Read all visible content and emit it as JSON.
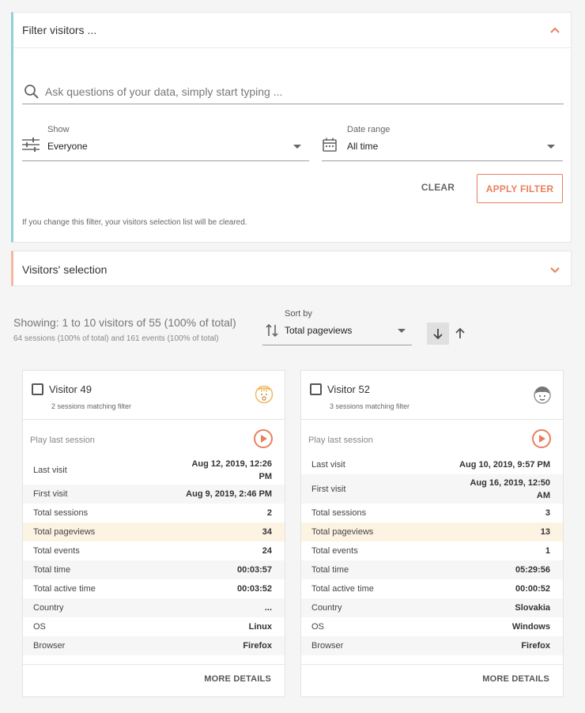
{
  "filter": {
    "title": "Filter visitors ...",
    "search_placeholder": "Ask questions of your data, simply start typing ...",
    "show": {
      "label": "Show",
      "value": "Everyone"
    },
    "date_range": {
      "label": "Date range",
      "value": "All time"
    },
    "clear_label": "CLEAR",
    "apply_label": "APPLY FILTER",
    "note": "If you change this filter, your visitors selection list will be cleared.",
    "accent": "#8fd1d4"
  },
  "selection": {
    "title": "Visitors' selection",
    "accent": "#f4b8a2"
  },
  "summary": {
    "showing": "Showing: 1 to 10 visitors of 55 (100% of total)",
    "sub": "64 sessions (100% of total) and 161 events (100% of total)"
  },
  "sort": {
    "label": "Sort by",
    "value": "Total pageviews"
  },
  "brand_color": "#e8805f",
  "cards": [
    {
      "name": "Visitor 49",
      "sub": "2 sessions matching filter",
      "avatar": "surprised-face-icon",
      "play_label": "Play last session",
      "stats": [
        {
          "k": "Last visit",
          "v": "Aug 12, 2019, 12:26 PM"
        },
        {
          "k": "First visit",
          "v": "Aug 9, 2019, 2:46 PM"
        },
        {
          "k": "Total sessions",
          "v": "2"
        },
        {
          "k": "Total pageviews",
          "v": "34"
        },
        {
          "k": "Total events",
          "v": "24"
        },
        {
          "k": "Total time",
          "v": "00:03:57"
        },
        {
          "k": "Total active time",
          "v": "00:03:52"
        },
        {
          "k": "Country",
          "v": "..."
        },
        {
          "k": "OS",
          "v": "Linux"
        },
        {
          "k": "Browser",
          "v": "Firefox"
        }
      ],
      "more_label": "MORE DETAILS"
    },
    {
      "name": "Visitor 52",
      "sub": "3 sessions matching filter",
      "avatar": "boy-face-icon",
      "play_label": "Play last session",
      "stats": [
        {
          "k": "Last visit",
          "v": "Aug 10, 2019, 9:57 PM"
        },
        {
          "k": "First visit",
          "v": "Aug 16, 2019, 12:50 AM"
        },
        {
          "k": "Total sessions",
          "v": "3"
        },
        {
          "k": "Total pageviews",
          "v": "13"
        },
        {
          "k": "Total events",
          "v": "1"
        },
        {
          "k": "Total time",
          "v": "05:29:56"
        },
        {
          "k": "Total active time",
          "v": "00:00:52"
        },
        {
          "k": "Country",
          "v": "Slovakia"
        },
        {
          "k": "OS",
          "v": "Windows"
        },
        {
          "k": "Browser",
          "v": "Firefox"
        }
      ],
      "more_label": "MORE DETAILS"
    }
  ]
}
